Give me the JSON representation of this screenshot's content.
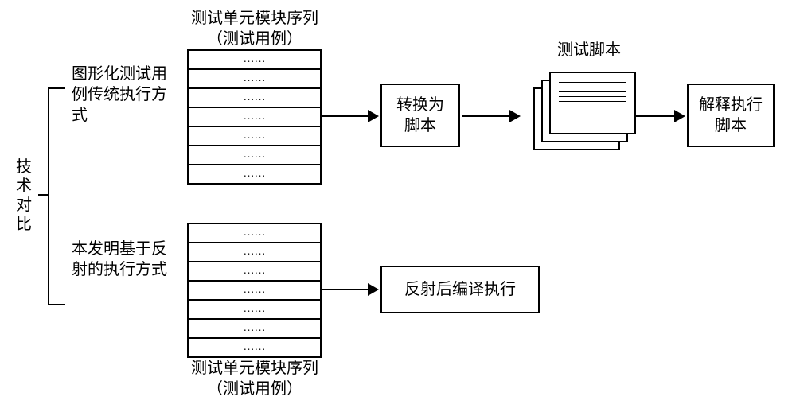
{
  "titles": {
    "top_sequence_title_1": "测试单元模块序列",
    "top_sequence_title_2": "（测试用例）",
    "bottom_sequence_title_1": "测试单元模块序列",
    "bottom_sequence_title_2": "（测试用例）"
  },
  "left_axis_label": "技术对比",
  "branch_top_label": "图形化测试用例传统执行方式",
  "branch_bottom_label": "本发明基于反射的执行方式",
  "boxes": {
    "convert_script": "转换为\n脚本",
    "reflect_compile": "反射后编译执行",
    "interpret_exec": "解释执行\n脚本"
  },
  "script_stack_label": "测试脚本",
  "ellipsis": "……",
  "chart_data": {
    "type": "diagram",
    "title": "技术对比",
    "branches": [
      {
        "name": "图形化测试用例传统执行方式",
        "flow": [
          "测试单元模块序列（测试用例）",
          "转换为脚本",
          "测试脚本",
          "解释执行脚本"
        ]
      },
      {
        "name": "本发明基于反射的执行方式",
        "flow": [
          "测试单元模块序列（测试用例）",
          "反射后编译执行"
        ]
      }
    ]
  }
}
